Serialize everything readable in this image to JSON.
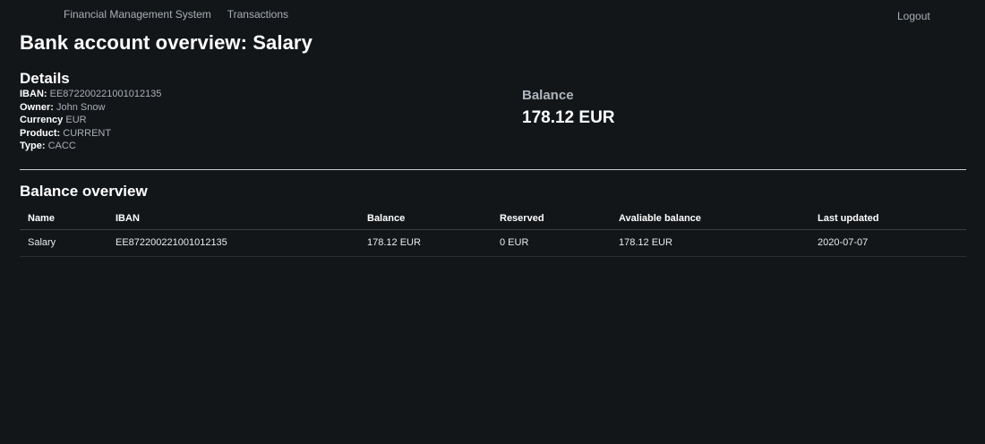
{
  "nav": {
    "brand": "Financial Management System",
    "transactions": "Transactions",
    "logout": "Logout"
  },
  "page": {
    "title": "Bank account overview: Salary"
  },
  "details": {
    "heading": "Details",
    "iban_label": "IBAN:",
    "iban_value": "EE872200221001012135",
    "owner_label": "Owner:",
    "owner_value": "John Snow",
    "currency_label": "Currency",
    "currency_value": "EUR",
    "product_label": "Product:",
    "product_value": "CURRENT",
    "type_label": "Type:",
    "type_value": "CACC"
  },
  "balance": {
    "label": "Balance",
    "value": "178.12 EUR"
  },
  "overview": {
    "heading": "Balance overview",
    "columns": [
      "Name",
      "IBAN",
      "Balance",
      "Reserved",
      "Avaliable balance",
      "Last updated"
    ],
    "rows": [
      [
        "Salary",
        "EE872200221001012135",
        "178.12 EUR",
        "0 EUR",
        "178.12 EUR",
        "2020-07-07"
      ]
    ]
  },
  "colors": {
    "background": "#131619",
    "text": "#ffffff",
    "muted": "#a9afb7"
  }
}
